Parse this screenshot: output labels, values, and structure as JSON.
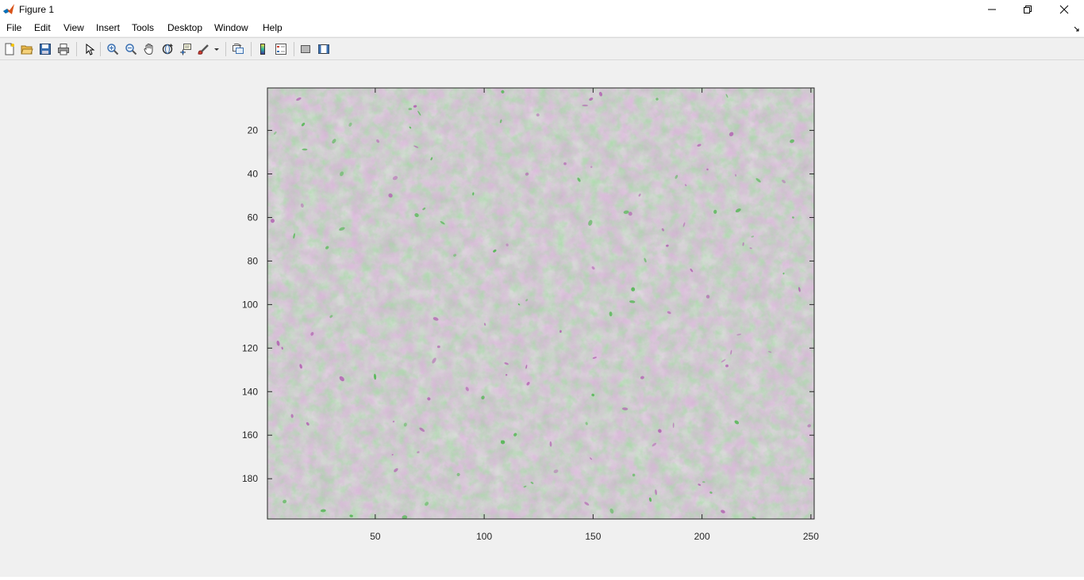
{
  "window": {
    "title": "Figure 1",
    "app_icon": "matlab-logo-icon",
    "controls": [
      "minimize-icon",
      "restore-icon",
      "close-icon"
    ]
  },
  "menu": {
    "items": [
      "File",
      "Edit",
      "View",
      "Insert",
      "Tools",
      "Desktop",
      "Window",
      "Help"
    ]
  },
  "toolbar": {
    "buttons": [
      "new-figure-icon",
      "open-file-icon",
      "save-figure-icon",
      "print-figure-icon",
      "edit-plot-icon",
      "zoom-in-icon",
      "zoom-out-icon",
      "pan-icon",
      "rotate-3d-icon",
      "data-cursor-icon",
      "brush-icon",
      "link-plot-icon",
      "insert-colorbar-icon",
      "insert-legend-icon",
      "hide-plot-tools-icon",
      "show-plot-tools-icon"
    ]
  },
  "chart_data": {
    "type": "heatmap",
    "description_of_content": "",
    "x_ticks": [
      50,
      100,
      150,
      200,
      250
    ],
    "y_ticks": [
      20,
      40,
      60,
      80,
      100,
      120,
      140,
      160,
      180
    ],
    "xlim": [
      0.5,
      251.5
    ],
    "ylim": [
      0.5,
      198.5
    ],
    "y_direction": "reverse",
    "colors": {
      "base": "#a8a8a8",
      "magenta": "#b46ab4",
      "green": "#5cb85c"
    }
  }
}
